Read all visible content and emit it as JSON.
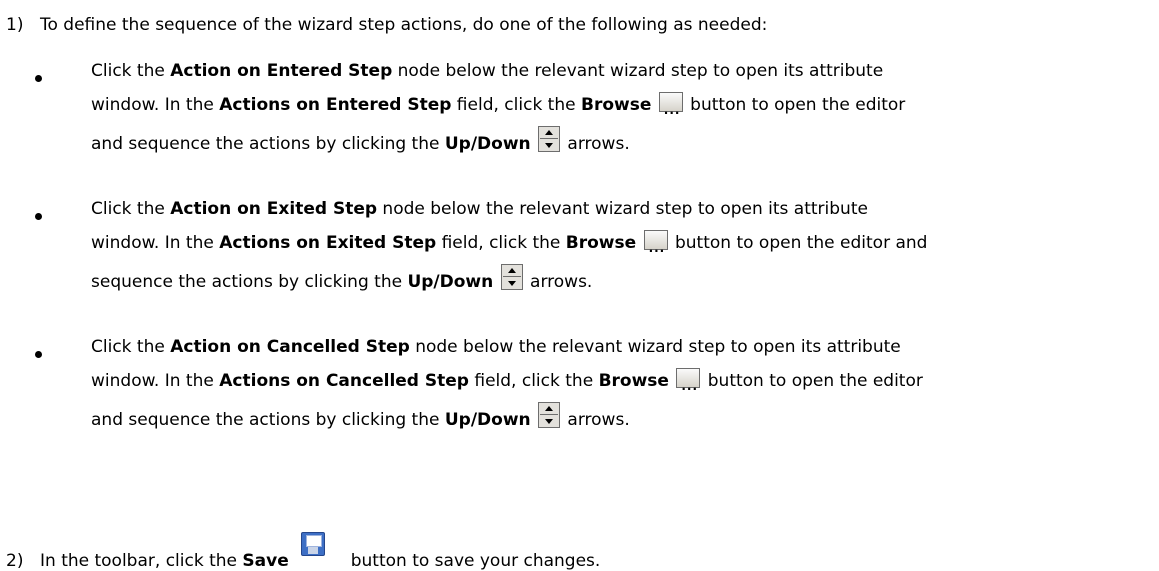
{
  "step1": {
    "number": "1)",
    "text": "To define the sequence of the wizard step actions, do one of the following as needed:"
  },
  "bullets": [
    {
      "l1_a": "Click the ",
      "l1_b": "Action on Entered Step",
      "l1_c": " node below the relevant wizard step to open its attribute",
      "l2_a": "window. In the ",
      "l2_b": "Actions on Entered Step",
      "l2_c": " field, click the ",
      "l2_d": "Browse",
      "l2_e": " button to open the editor",
      "l3_a": "and sequence the actions by clicking the ",
      "l3_b": "Up/Down",
      "l3_c": " arrows."
    },
    {
      "l1_a": "Click the ",
      "l1_b": "Action on Exited Step",
      "l1_c": " node below the relevant wizard step to open its attribute",
      "l2_a": "window. In the ",
      "l2_b": "Actions on Exited Step",
      "l2_c": " field, click the ",
      "l2_d": "Browse",
      "l2_e": " button to open the editor and",
      "l3_a": "sequence the actions by clicking the ",
      "l3_b": "Up/Down",
      "l3_c": " arrows."
    },
    {
      "l1_a": "Click the ",
      "l1_b": "Action on Cancelled Step",
      "l1_c": " node below the relevant wizard step to open its attribute",
      "l2_a": "window. In the ",
      "l2_b": "Actions on Cancelled Step",
      "l2_c": " field, click the ",
      "l2_d": "Browse",
      "l2_e": " button to open the editor",
      "l3_a": "and sequence the actions by clicking the ",
      "l3_b": "Up/Down",
      "l3_c": " arrows."
    }
  ],
  "step2": {
    "number": "2)",
    "text_a": "In the toolbar, click the ",
    "text_b": "Save",
    "text_c": "button to save your changes."
  },
  "icons": {
    "browse": "browse-ellipsis-icon",
    "updown": "up-down-arrows-icon",
    "save": "floppy-disk-save-icon"
  }
}
